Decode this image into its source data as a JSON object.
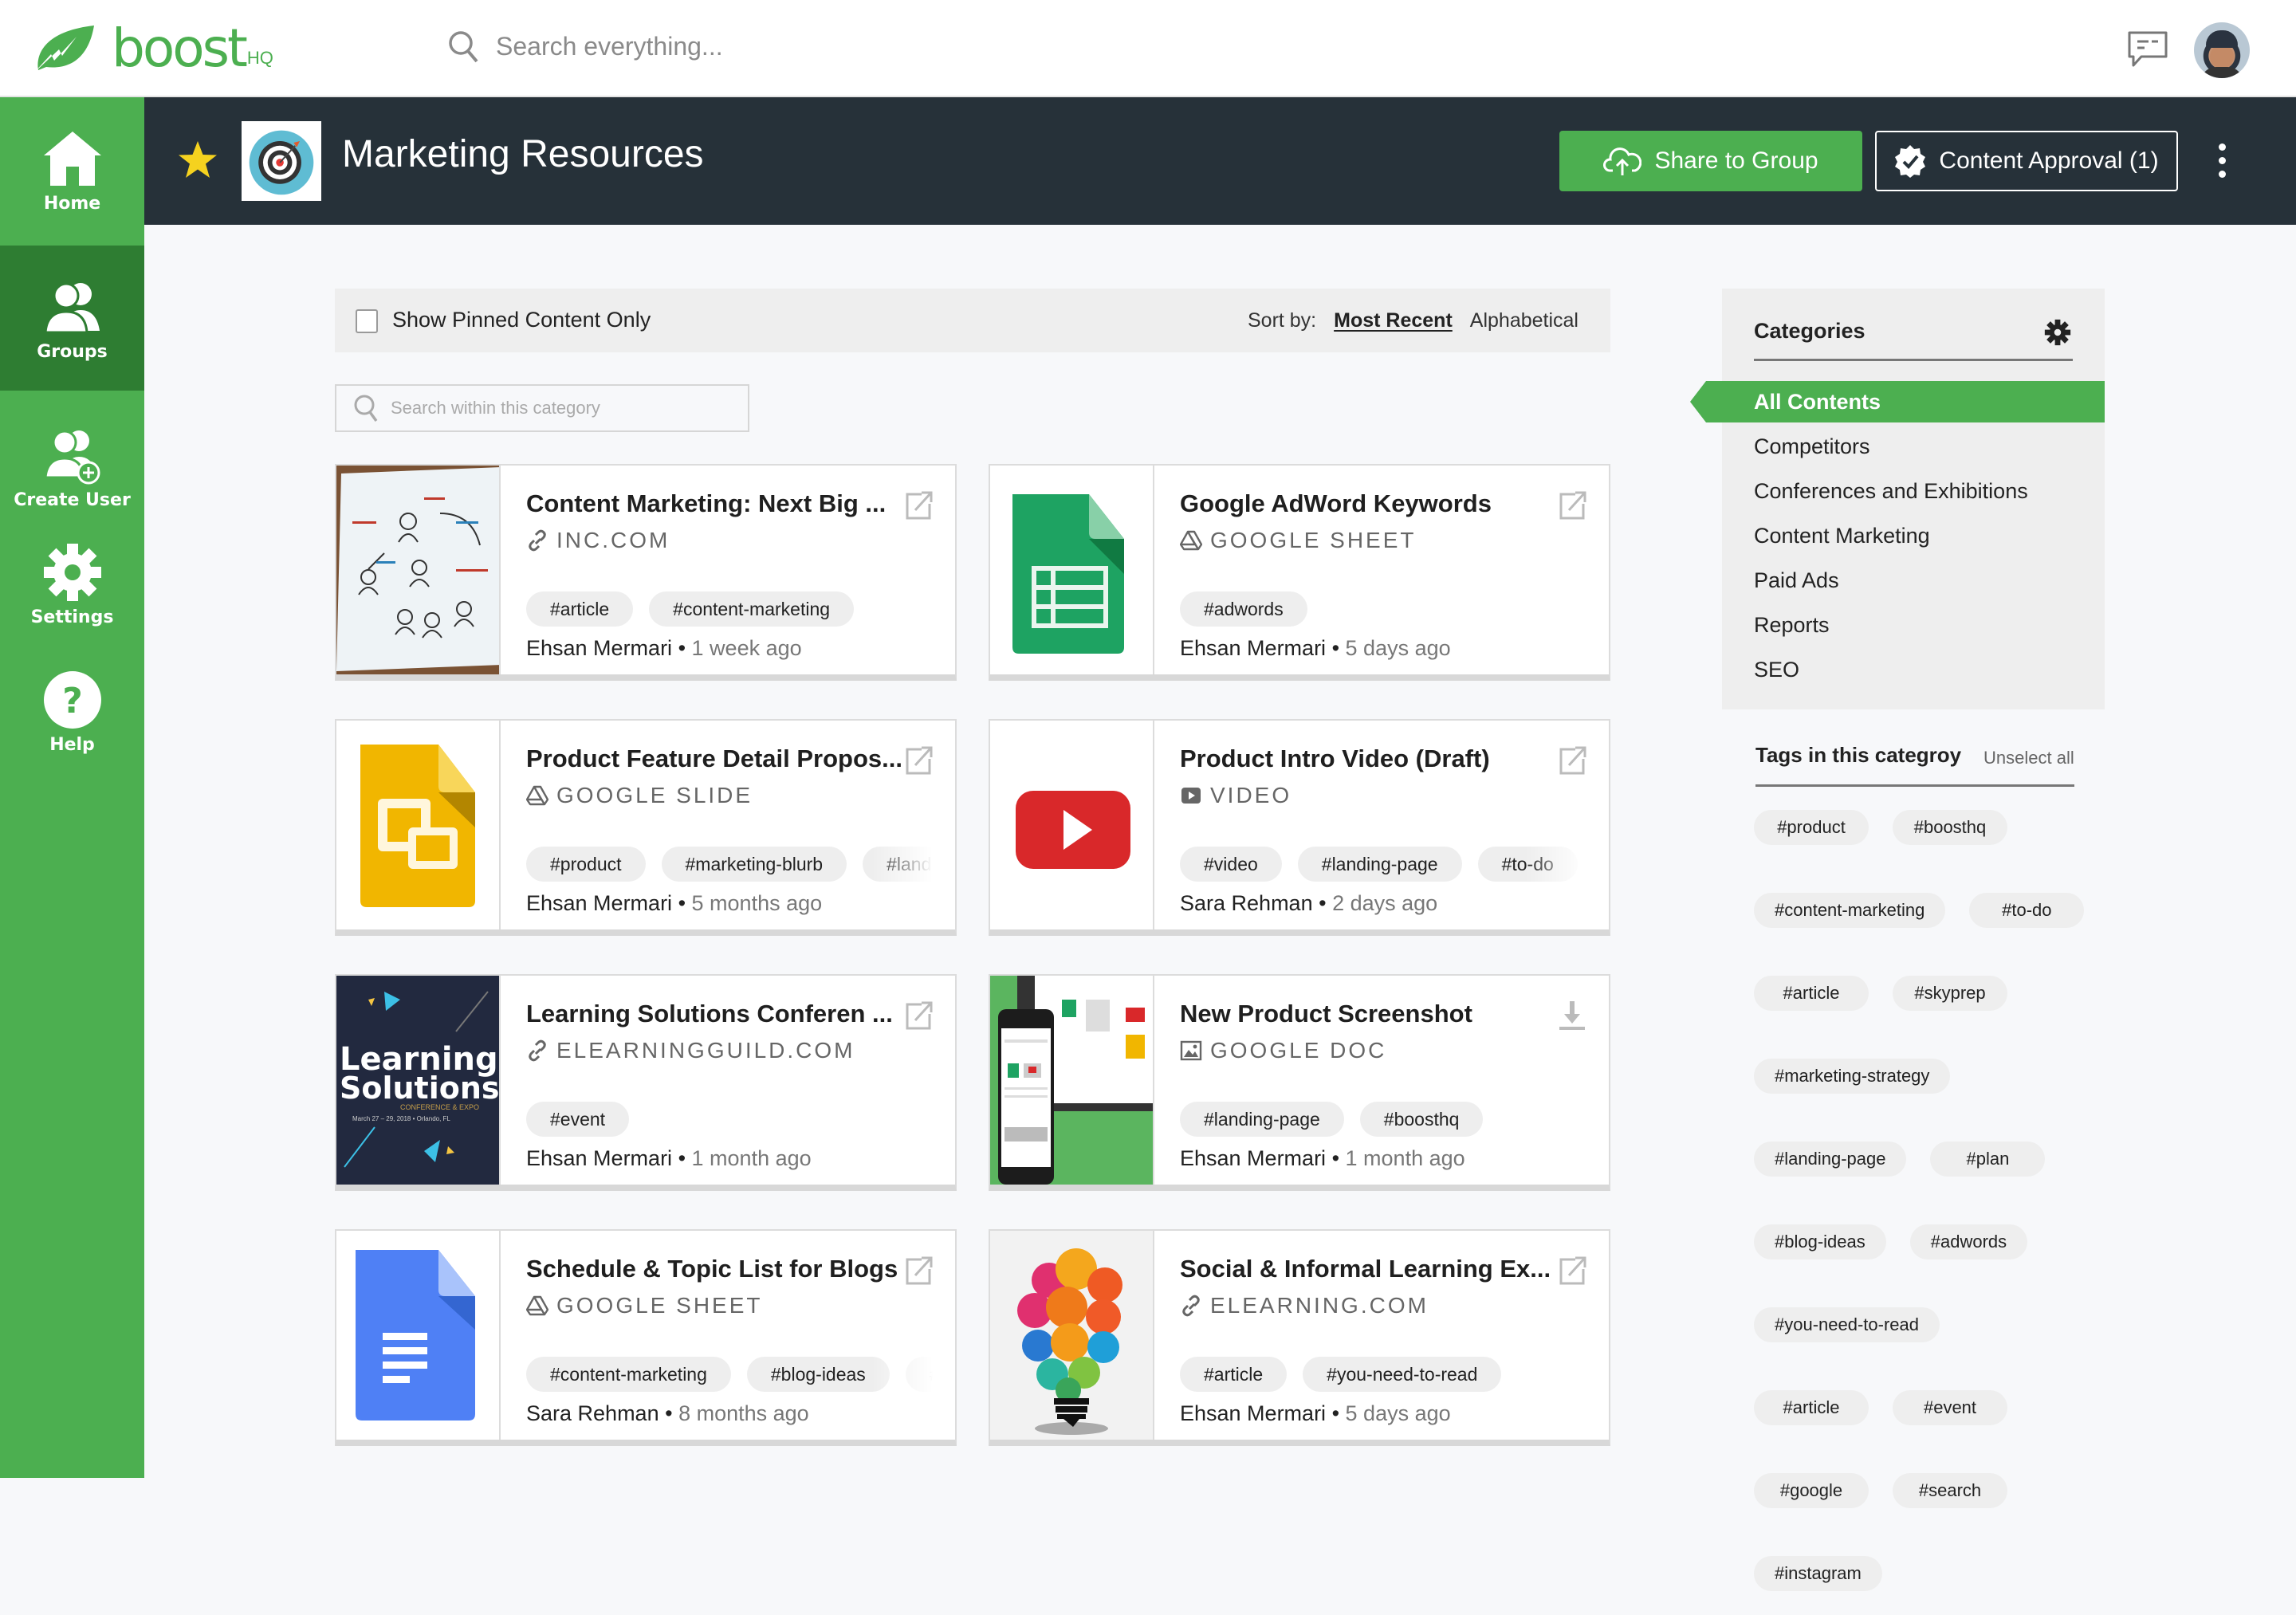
{
  "app": {
    "brand": "boost",
    "brand_suffix": "HQ",
    "search_placeholder": "Search everything..."
  },
  "nav": [
    {
      "id": "home",
      "label": "Home",
      "icon": "home-icon",
      "active": false
    },
    {
      "id": "groups",
      "label": "Groups",
      "icon": "groups-icon",
      "active": true
    },
    {
      "id": "create-user",
      "label": "Create User",
      "icon": "add-user-icon",
      "active": false
    },
    {
      "id": "settings",
      "label": "Settings",
      "icon": "gear-icon",
      "active": false
    },
    {
      "id": "help",
      "label": "Help",
      "icon": "help-icon",
      "active": false
    }
  ],
  "group": {
    "title": "Marketing Resources",
    "starred": true,
    "share_label": "Share to Group",
    "approval_label": "Content Approval (1)"
  },
  "filters": {
    "pinned_label": "Show Pinned Content Only",
    "pinned_checked": false,
    "sort_label": "Sort by:",
    "sort_options": [
      "Most Recent",
      "Alphabetical"
    ],
    "sort_selected": "Most Recent",
    "category_search_placeholder": "Search within this category"
  },
  "cards": [
    {
      "title": "Content Marketing: Next Big ...",
      "source": "INC.COM",
      "source_icon": "link-icon",
      "tags": [
        "#article",
        "#content-marketing"
      ],
      "author": "Ehsan Mermari",
      "time": "1 week ago",
      "thumb": "whiteboard",
      "action": "external-link-icon"
    },
    {
      "title": "Google AdWord Keywords",
      "source": "GOOGLE SHEET",
      "source_icon": "drive-icon",
      "tags": [
        "#adwords"
      ],
      "author": "Ehsan Mermari",
      "time": "5 days ago",
      "thumb": "sheets",
      "action": "external-link-icon"
    },
    {
      "title": "Product Feature Detail Propos...",
      "source": "GOOGLE SLIDE",
      "source_icon": "drive-icon",
      "tags": [
        "#product",
        "#marketing-blurb",
        "#landing-page"
      ],
      "author": "Ehsan Mermari",
      "time": "5 months ago",
      "thumb": "slides",
      "action": "external-link-icon"
    },
    {
      "title": "Product Intro Video (Draft)",
      "source": "VIDEO",
      "source_icon": "video-icon",
      "tags": [
        "#video",
        "#landing-page",
        "#to-do"
      ],
      "author": "Sara Rehman",
      "time": "2 days ago",
      "thumb": "youtube",
      "action": "external-link-icon"
    },
    {
      "title": "Learning Solutions Conferen ...",
      "source": "ELEARNINGGUILD.COM",
      "source_icon": "link-icon",
      "tags": [
        "#event"
      ],
      "author": "Ehsan Mermari",
      "time": "1 month ago",
      "thumb": "conference",
      "action": "external-link-icon"
    },
    {
      "title": "New Product Screenshot",
      "source": "GOOGLE DOC",
      "source_icon": "image-icon",
      "tags": [
        "#landing-page",
        "#boosthq"
      ],
      "author": "Ehsan Mermari",
      "time": "1 month ago",
      "thumb": "phone",
      "action": "download-icon"
    },
    {
      "title": "Schedule & Topic List for Blogs",
      "source": "GOOGLE SHEET",
      "source_icon": "drive-icon",
      "tags": [
        "#content-marketing",
        "#blog-ideas",
        "#"
      ],
      "author": "Sara Rehman",
      "time": "8 months ago",
      "thumb": "docs",
      "action": "external-link-icon"
    },
    {
      "title": "Social & Informal Learning Ex...",
      "source": "ELEARNING.COM",
      "source_icon": "link-icon",
      "tags": [
        "#article",
        "#you-need-to-read"
      ],
      "author": "Ehsan Mermari",
      "time": "5 days ago",
      "thumb": "bulb",
      "action": "external-link-icon"
    }
  ],
  "categories": {
    "title": "Categories",
    "items": [
      "All Contents",
      "Competitors",
      "Conferences and Exhibitions",
      "Content Marketing",
      "Paid Ads",
      "Reports",
      "SEO"
    ],
    "selected": "All Contents"
  },
  "tags_panel": {
    "title": "Tags in this categroy",
    "unselect_label": "Unselect all",
    "rows": [
      [
        "#product",
        "#boosthq"
      ],
      [
        "#content-marketing",
        "#to-do"
      ],
      [
        "#article",
        "#skyprep"
      ],
      [
        "#marketing-strategy"
      ],
      [
        "#landing-page",
        "#plan"
      ],
      [
        "#blog-ideas",
        "#adwords"
      ],
      [
        "#you-need-to-read"
      ],
      [
        "#article",
        "#event"
      ],
      [
        "#google",
        "#search"
      ],
      [
        "#instagram"
      ]
    ]
  },
  "colors": {
    "brand_green": "#4caf50",
    "active_nav": "#2e7d32",
    "header_dark": "#263139",
    "star": "#f5d21f"
  }
}
